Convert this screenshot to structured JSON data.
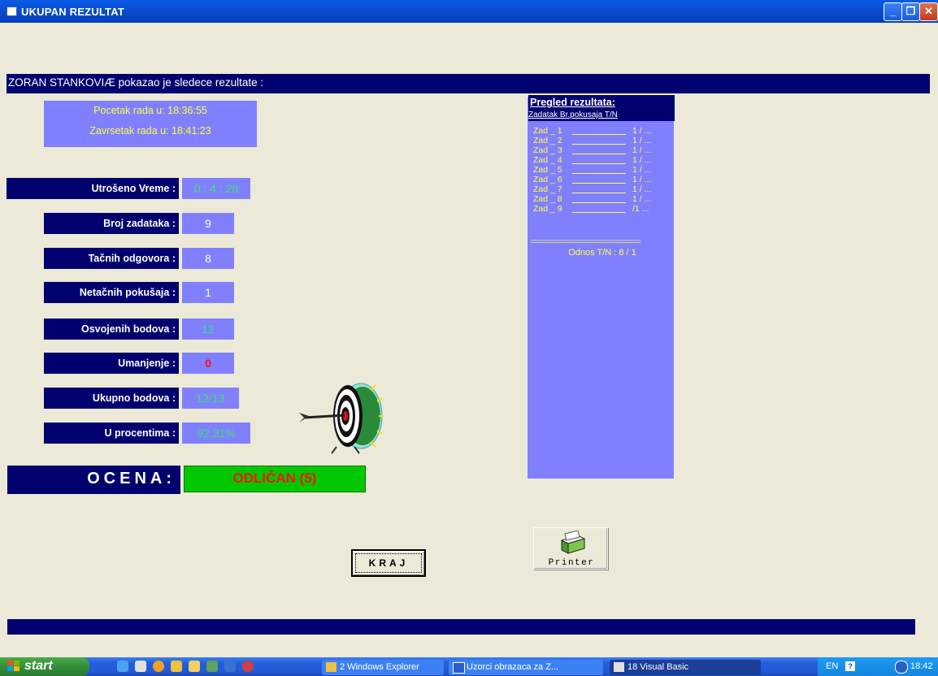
{
  "window": {
    "title": "UKUPAN REZULTAT"
  },
  "headline": "ZORAN  STANKOVIÆ pokazao je sledece rezultate :",
  "times": {
    "start": "Pocetak rada u:  18:36:55",
    "end": "Zavrsetak rada u:  18:41:23"
  },
  "stats": [
    {
      "label": "Utrošeno Vreme :",
      "value": "0 : 4 : 28"
    },
    {
      "label": "Broj zadataka :",
      "value": "9"
    },
    {
      "label": "Tačnih odgovora :",
      "value": "8"
    },
    {
      "label": "Netačnih pokušaja :",
      "value": "1"
    },
    {
      "label": "Osvojenih bodova :",
      "value": "12"
    },
    {
      "label": "Umanjenje :",
      "value": "0"
    },
    {
      "label": "Ukupno bodova :",
      "value": "12/13"
    },
    {
      "label": "U procentima :",
      "value": "92,31%"
    }
  ],
  "grade": {
    "label": "OCENA:",
    "value": "ODLIČAN  (5)"
  },
  "results": {
    "title": "Pregled rezultata:",
    "subheader": "Zadatak      Br.pokusaja T/N",
    "rows": [
      {
        "task": "Zad _ 1",
        "val": "1 / ..."
      },
      {
        "task": "Zad _ 2",
        "val": "1 / ..."
      },
      {
        "task": "Zad _ 3",
        "val": "1 / ..."
      },
      {
        "task": "Zad _ 4",
        "val": "1 / ..."
      },
      {
        "task": "Zad _ 5",
        "val": "1 / ..."
      },
      {
        "task": "Zad _ 6",
        "val": "1 / ..."
      },
      {
        "task": "Zad _ 7",
        "val": "1 / ..."
      },
      {
        "task": "Zad _ 8",
        "val": "1 / ..."
      },
      {
        "task": "Zad _ 9",
        "val": "  /1 ..."
      }
    ],
    "separator": "================================",
    "ratio": "Odnos T/N : 8 / 1"
  },
  "buttons": {
    "kraj": "KRAJ",
    "printer": "Printer"
  },
  "taskbar": {
    "start": "start",
    "items": [
      "2 Windows Explorer",
      "Uzorci obrazaca za Z...",
      "18 Visual Basic"
    ],
    "lang": "EN",
    "clock": "18:42"
  },
  "colors": {
    "navy": "#00006e",
    "periwinkle": "#8080ff",
    "yellow": "#ffff40",
    "green": "#3be06a",
    "red": "#ff1010"
  }
}
